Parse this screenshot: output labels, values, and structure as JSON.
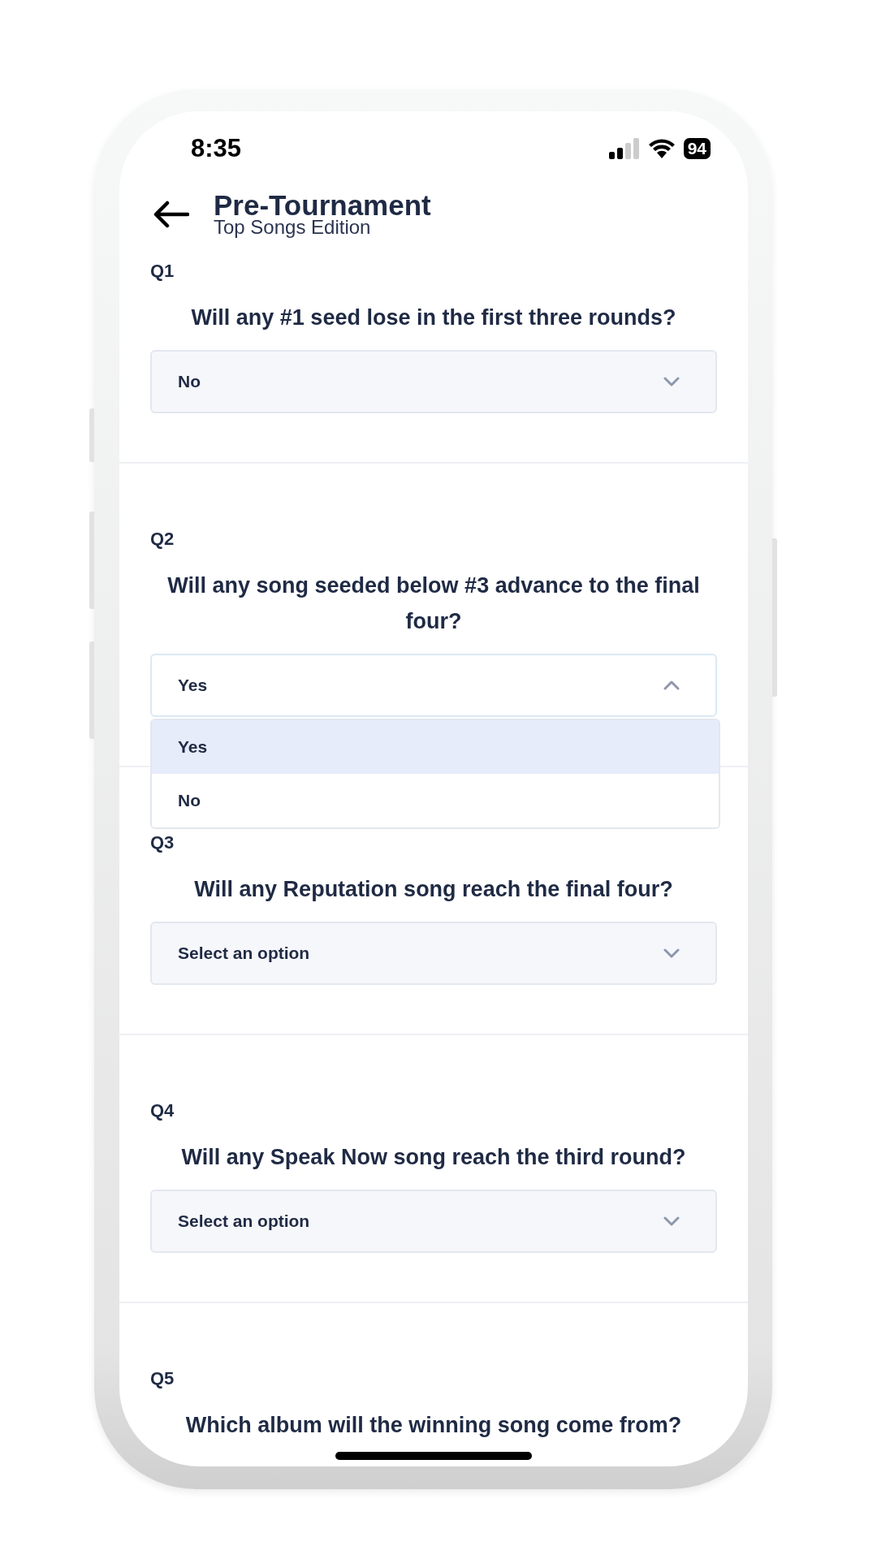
{
  "status_bar": {
    "time": "8:35",
    "battery": "94"
  },
  "header": {
    "title": "Pre-Tournament",
    "subtitle": "Top Songs Edition"
  },
  "questions": [
    {
      "label": "Q1",
      "text": "Will any #1 seed lose in the first three rounds?",
      "select": {
        "value": "No",
        "expanded": false
      }
    },
    {
      "label": "Q2",
      "text": "Will any song seeded below #3 advance to the final four?",
      "select": {
        "value": "Yes",
        "expanded": true,
        "options": [
          {
            "label": "Yes",
            "selected": true
          },
          {
            "label": "No",
            "selected": false
          }
        ]
      }
    },
    {
      "label": "Q3",
      "text": "Will any Reputation song reach the final four?",
      "select": {
        "placeholder": "Select an option",
        "expanded": false
      }
    },
    {
      "label": "Q4",
      "text": "Will any Speak Now song reach the third round?",
      "select": {
        "placeholder": "Select an option",
        "expanded": false
      }
    },
    {
      "label": "Q5",
      "text": "Which album will the winning song come from?"
    }
  ]
}
